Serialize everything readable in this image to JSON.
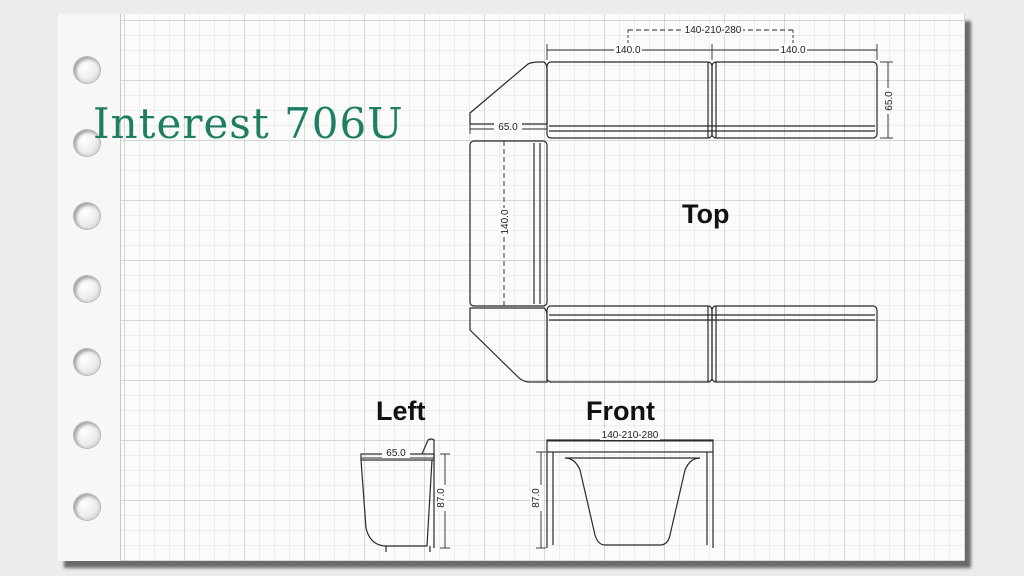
{
  "title": "Interest 706U",
  "views": {
    "top": "Top",
    "left": "Left",
    "front": "Front"
  },
  "dimensions": {
    "overall_width": "140-210-280",
    "module_width_1": "140.0",
    "module_width_2": "140.0",
    "seat_depth_right": "65.0",
    "corner_depth": "65.0",
    "side_length": "140.0",
    "left_depth": "65.0",
    "left_height": "87.0",
    "front_width": "140-210-280",
    "front_height": "87.0"
  },
  "colors": {
    "title": "#1e7e64",
    "line": "#2a2a2a",
    "paper": "#fbfbf9"
  }
}
